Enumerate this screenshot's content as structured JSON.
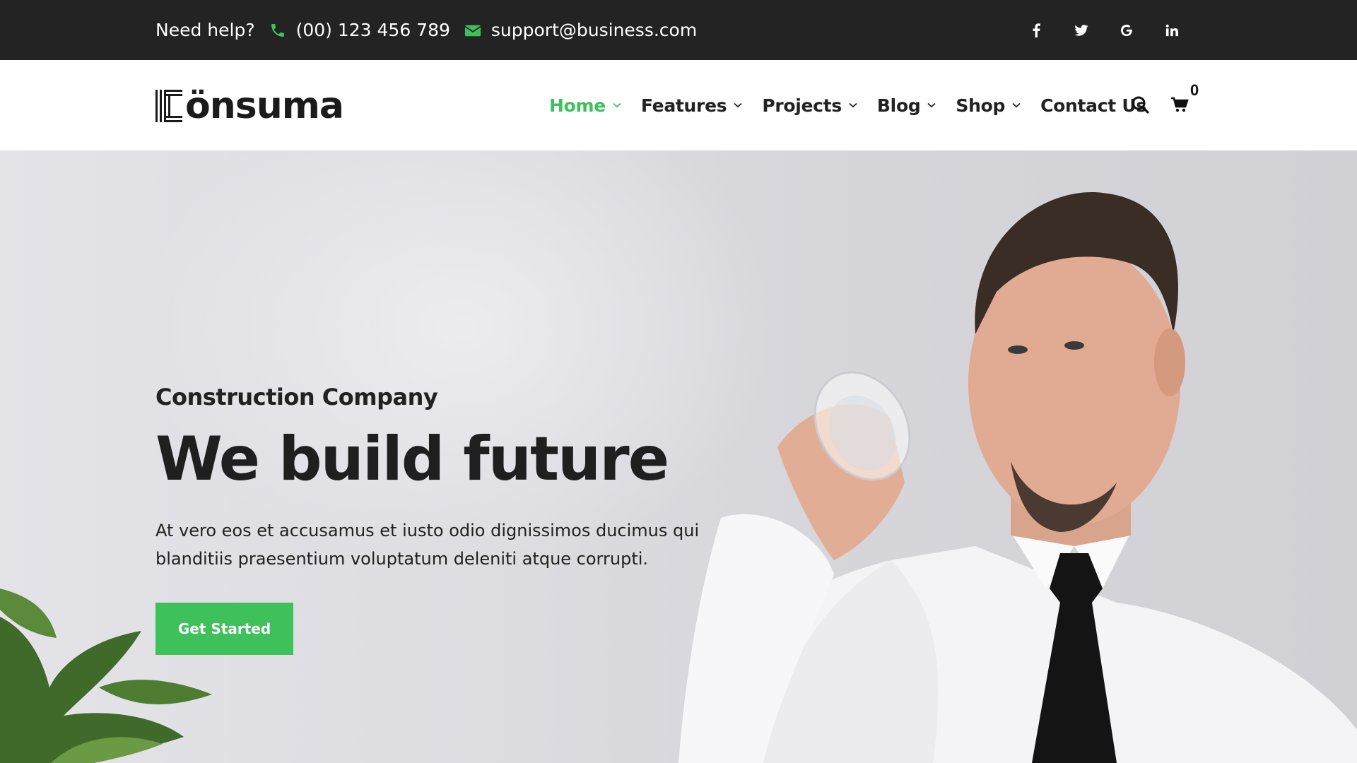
{
  "topbar": {
    "help_label": "Need help?",
    "phone": "(00) 123 456 789",
    "email": "support@business.com",
    "social": [
      {
        "name": "facebook-icon",
        "glyph": "f"
      },
      {
        "name": "twitter-icon",
        "glyph": "twitter"
      },
      {
        "name": "google-icon",
        "glyph": "G"
      },
      {
        "name": "linkedin-icon",
        "glyph": "in"
      }
    ]
  },
  "header": {
    "logo_text": "önsuma",
    "nav": [
      {
        "label": "Home",
        "active": true,
        "dropdown": true
      },
      {
        "label": "Features",
        "active": false,
        "dropdown": true
      },
      {
        "label": "Projects",
        "active": false,
        "dropdown": true
      },
      {
        "label": "Blog",
        "active": false,
        "dropdown": true
      },
      {
        "label": "Shop",
        "active": false,
        "dropdown": true
      },
      {
        "label": "Contact Us",
        "active": false,
        "dropdown": false
      }
    ],
    "cart_count": "0"
  },
  "hero": {
    "subtitle": "Construction Company",
    "title": "We build future",
    "description": "At vero eos et accusamus et iusto odio dignissimos ducimus qui blanditiis praesentium voluptatum deleniti atque corrupti.",
    "cta_label": "Get Started"
  },
  "colors": {
    "accent": "#3ec15a",
    "topbar_bg": "#232323",
    "text_dark": "#1f1f1f"
  }
}
